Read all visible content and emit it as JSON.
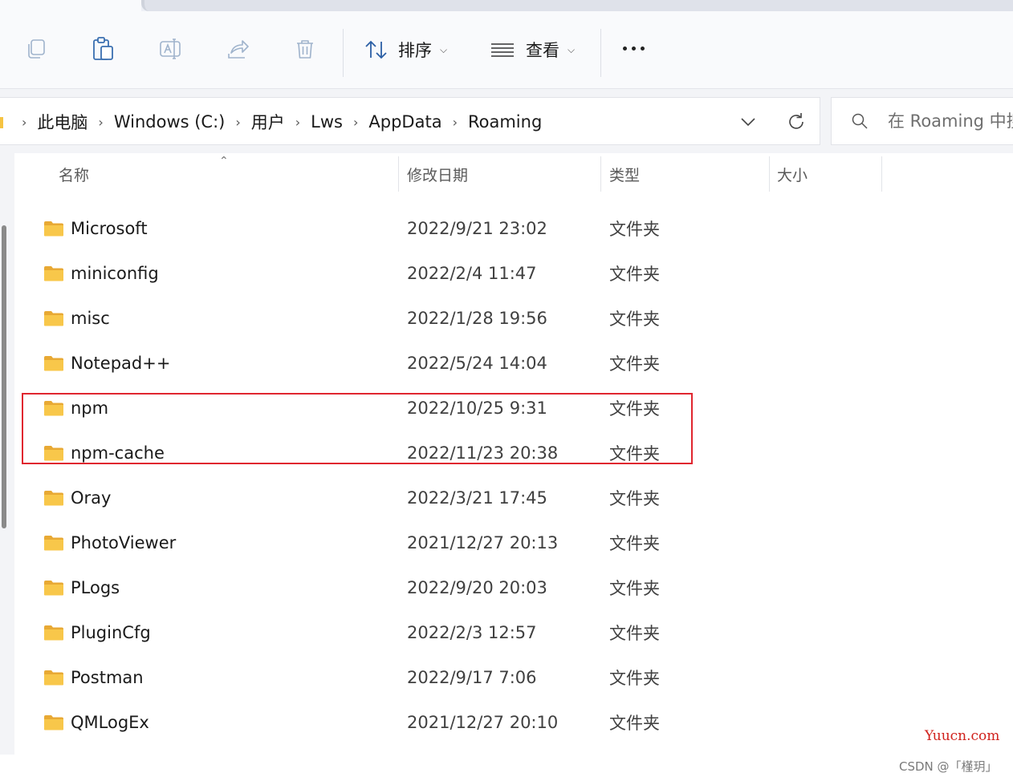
{
  "toolbar": {
    "sort_label": "排序",
    "view_label": "查看"
  },
  "address": {
    "crumbs": [
      "此电脑",
      "Windows (C:)",
      "用户",
      "Lws",
      "AppData",
      "Roaming"
    ]
  },
  "search": {
    "placeholder": "在 Roaming 中搜索"
  },
  "columns": {
    "name": "名称",
    "modified": "修改日期",
    "type": "类型",
    "size": "大小"
  },
  "files": [
    {
      "name": "Microsoft",
      "modified": "2022/9/21 23:02",
      "type": "文件夹"
    },
    {
      "name": "miniconfig",
      "modified": "2022/2/4 11:47",
      "type": "文件夹"
    },
    {
      "name": "misc",
      "modified": "2022/1/28 19:56",
      "type": "文件夹"
    },
    {
      "name": "Notepad++",
      "modified": "2022/5/24 14:04",
      "type": "文件夹"
    },
    {
      "name": "npm",
      "modified": "2022/10/25 9:31",
      "type": "文件夹"
    },
    {
      "name": "npm-cache",
      "modified": "2022/11/23 20:38",
      "type": "文件夹"
    },
    {
      "name": "Oray",
      "modified": "2022/3/21 17:45",
      "type": "文件夹"
    },
    {
      "name": "PhotoViewer",
      "modified": "2021/12/27 20:13",
      "type": "文件夹"
    },
    {
      "name": "PLogs",
      "modified": "2022/9/20 20:03",
      "type": "文件夹"
    },
    {
      "name": "PluginCfg",
      "modified": "2022/2/3 12:57",
      "type": "文件夹"
    },
    {
      "name": "Postman",
      "modified": "2022/9/17 7:06",
      "type": "文件夹"
    },
    {
      "name": "QMLogEx",
      "modified": "2021/12/27 20:10",
      "type": "文件夹"
    }
  ],
  "watermark": {
    "site": "Yuucn.com",
    "credit": "CSDN @「槿玥」"
  },
  "colors": {
    "highlight": "#e0262f",
    "folder": "#f6c342",
    "watermark": "#d0211c"
  }
}
